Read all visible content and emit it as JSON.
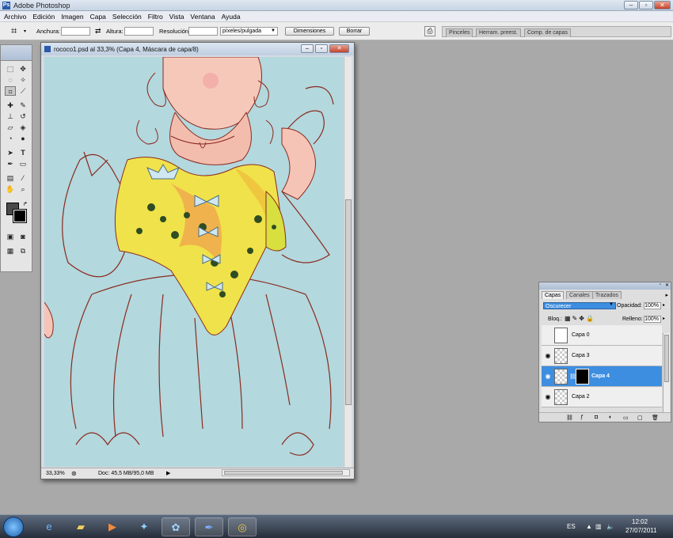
{
  "app": {
    "title": "Adobe Photoshop"
  },
  "menu": [
    "Archivo",
    "Edición",
    "Imagen",
    "Capa",
    "Selección",
    "Filtro",
    "Vista",
    "Ventana",
    "Ayuda"
  ],
  "options": {
    "width_label": "Anchura:",
    "height_label": "Altura:",
    "resolution_label": "Resolución:",
    "units_value": "píxeles/pulgada",
    "dimensions_button": "Dimensiones",
    "clear_button": "Borrar"
  },
  "panel_well": {
    "tabs": [
      "Pinceles",
      "Herram. preest.",
      "Comp. de capas"
    ]
  },
  "document": {
    "title": "rococo1.psd al 33,3% (Capa 4, Máscara de capa/8)",
    "zoom": "33,33%",
    "doc_size": "Doc: 45,5 MB/95,0 MB"
  },
  "layers_panel": {
    "tabs": [
      "Capas",
      "Canales",
      "Trazados"
    ],
    "blend_mode": "Oscurecer",
    "opacity_label": "Opacidad:",
    "opacity_value": "100%",
    "lock_label": "Bloq.:",
    "fill_label": "Relleno:",
    "fill_value": "100%",
    "layers": [
      {
        "name": "Capa 0",
        "selected": false
      },
      {
        "name": "Capa 3",
        "selected": false
      },
      {
        "name": "Capa 4",
        "selected": true
      },
      {
        "name": "Capa 2",
        "selected": false
      }
    ]
  },
  "taskbar": {
    "language": "ES",
    "time": "12:02",
    "date": "27/07/2011"
  },
  "colors": {
    "accent": "#3d8ee0",
    "canvas_bg": "#b3d8dd",
    "workspace": "#a9a9a9"
  }
}
